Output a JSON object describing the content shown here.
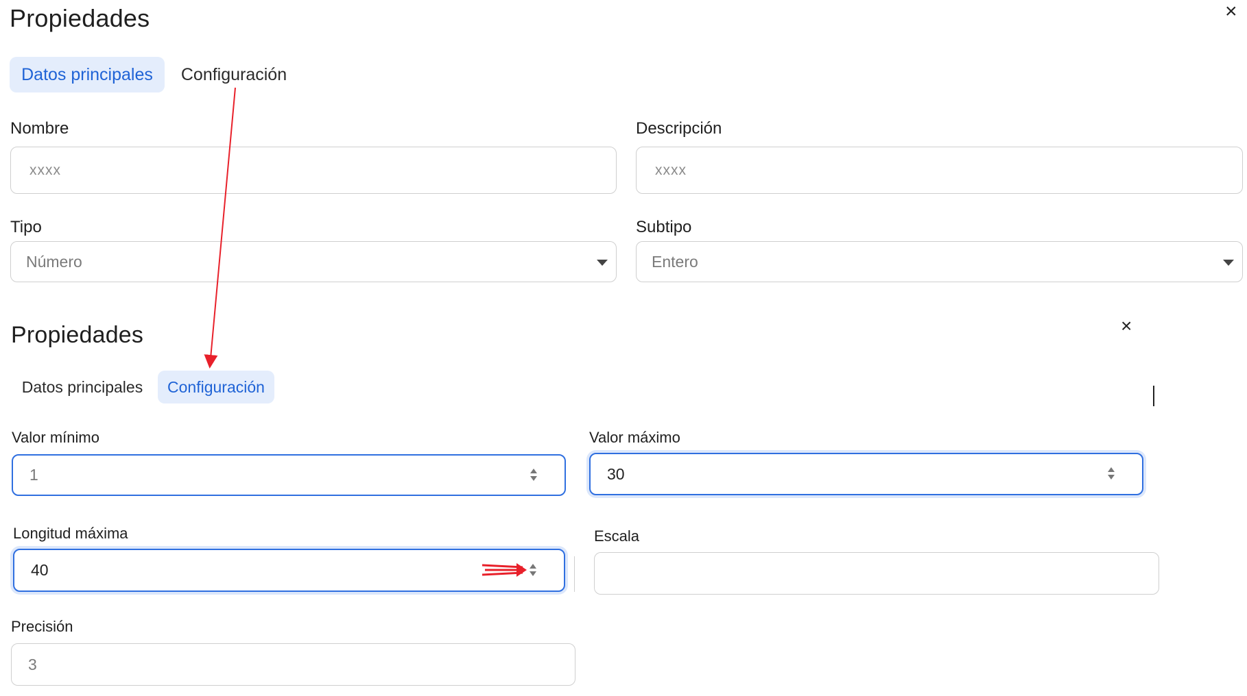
{
  "top_panel": {
    "title": "Propiedades",
    "close_icon": "×",
    "tabs": [
      {
        "label": "Datos principales",
        "active": true
      },
      {
        "label": "Configuración",
        "active": false
      }
    ],
    "fields": {
      "nombre": {
        "label": "Nombre",
        "value": "xxxx"
      },
      "descripcion": {
        "label": "Descripción",
        "value": "xxxx"
      },
      "tipo": {
        "label": "Tipo",
        "value": "Número"
      },
      "subtipo": {
        "label": "Subtipo",
        "value": "Entero"
      }
    }
  },
  "bottom_panel": {
    "title": "Propiedades",
    "close_icon": "×",
    "tabs": [
      {
        "label": "Datos principales",
        "active": false
      },
      {
        "label": "Configuración",
        "active": true
      }
    ],
    "fields": {
      "valor_minimo": {
        "label": "Valor mínimo",
        "value": "1"
      },
      "valor_maximo": {
        "label": "Valor máximo",
        "value": "30"
      },
      "longitud_maxima": {
        "label": "Longitud máxima",
        "value": "40"
      },
      "escala": {
        "label": "Escala",
        "value": ""
      },
      "precision": {
        "label": "Precisión",
        "value": "3"
      }
    }
  },
  "annotation_color": "#e8202a",
  "accent_color": "#1f63d6"
}
